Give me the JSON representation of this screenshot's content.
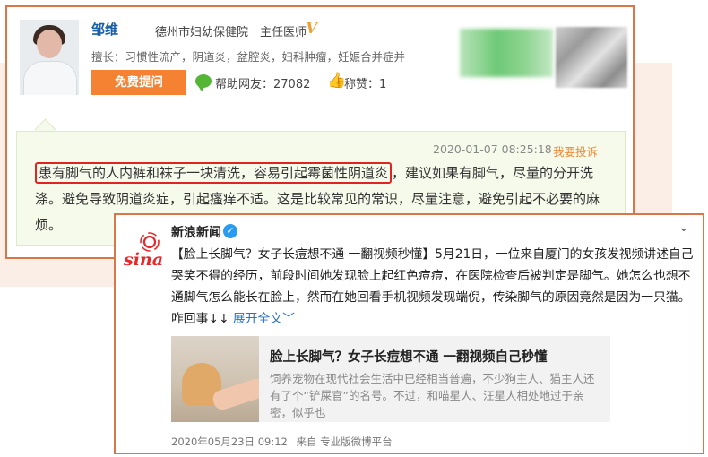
{
  "doctor": {
    "name": "邹维",
    "hospital": "德州市妇幼保健院",
    "title": "主任医师",
    "specialty": "擅长：习惯性流产，阴道炎，盆腔炎，妇科肿瘤，妊娠合并症并",
    "ask_button": "免费提问",
    "helped": "帮助网友：27082",
    "likes": "称赞：1"
  },
  "answer": {
    "time": "2020-01-07 08:25:18",
    "report": "我要投诉",
    "highlighted": "患有脚气的人内裤和袜子一块清洗，容易引起霉菌性阴道炎",
    "rest": "，建议如果有脚气，尽量的分开洗涤。避免导致阴道炎症，引起瘙痒不适。这是比较常见的常识，尽量注意，避免引起不必要的麻烦。"
  },
  "weibo": {
    "account": "新浪新闻",
    "logo_text": "sina",
    "post": "【脸上长脚气？女子长痘想不通 一翻视频秒懂】5月21日，一位来自厦门的女孩发视频讲述自己哭笑不得的经历，前段时间她发现脸上起红色痘痘，在医院检查后被判定是脚气。她怎么也想不通脚气怎么能长在脸上，然而在她回看手机视频发现端倪，传染脚气的原因竟然是因为一只猫。咋回事↓↓",
    "expand": "展开全文",
    "card_title": "脸上长脚气？女子长痘想不通 一翻视频自己秒懂",
    "card_desc": "饲养宠物在现代社会生活中已经相当普遍，不少狗主人、猫主人还有了个“铲屎官”的名号。不过，和喵星人、汪星人相处地过于亲密，似乎也",
    "date": "2020年05月23日 09:12",
    "source": "来自 专业版微博平台"
  },
  "colors": {
    "border": "#d9764a",
    "ask_button": "#f58232",
    "highlight": "#e02424",
    "link": "#2a72c5"
  }
}
